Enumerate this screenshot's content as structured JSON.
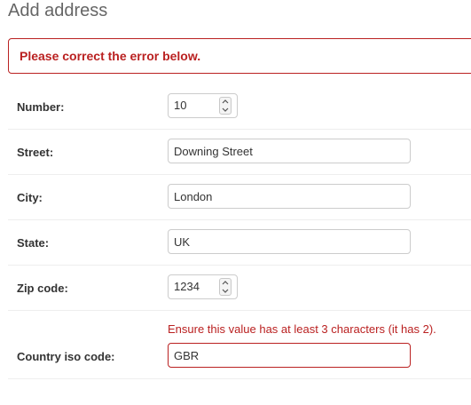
{
  "title": "Add address",
  "errornote": "Please correct the error below.",
  "fields": {
    "number": {
      "label": "Number:",
      "value": "10"
    },
    "street": {
      "label": "Street:",
      "value": "Downing Street"
    },
    "city": {
      "label": "City:",
      "value": "London"
    },
    "state": {
      "label": "State:",
      "value": "UK"
    },
    "zip_code": {
      "label": "Zip code:",
      "value": "1234"
    },
    "country_iso_code": {
      "label": "Country iso code:",
      "value": "GBR",
      "error": "Ensure this value has at least 3 characters (it has 2)."
    }
  },
  "colors": {
    "error": "#ba2121",
    "label": "#333333",
    "title": "#666666",
    "border": "#cccccc",
    "row_divider": "#eeeeee"
  }
}
